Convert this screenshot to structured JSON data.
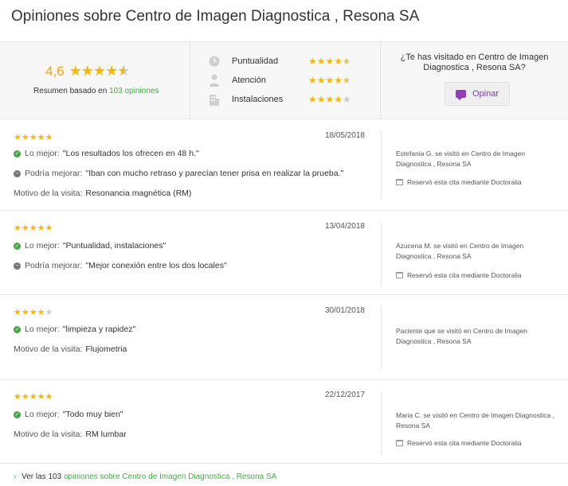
{
  "page_title": "Opiniones sobre Centro de Imagen Diagnostica , Resona SA",
  "summary": {
    "average": "4,6",
    "average_stars": 4.6,
    "based_on_prefix": "Resumen basado en",
    "opinions_link": "103 opiniones",
    "criteria": [
      {
        "label": "Puntualidad",
        "icon": "clock-icon",
        "rating": 4.5
      },
      {
        "label": "Atención",
        "icon": "person-icon",
        "rating": 4.5
      },
      {
        "label": "Instalaciones",
        "icon": "building-icon",
        "rating": 4
      }
    ],
    "question": "¿Te has visitado en Centro de Imagen Diagnostica , Resona SA?",
    "opinar_label": "Opinar"
  },
  "reviews": [
    {
      "rating": 5,
      "date": "18/05/2018",
      "best_label": "Lo mejor:",
      "best": "\"Los resultados los ofrecen en 48 h.\"",
      "improve_label": "Podría mejorar:",
      "improve": "\"Iban con mucho retraso y parecían tener prisa en realizar la prueba.\"",
      "reason_label": "Motivo de la visita:",
      "reason": "Resonancia magnética (RM)",
      "author": "Estefania G. se visitó en Centro de Imagen Diagnostica , Resona SA",
      "booked": "Reservó esta cita mediante Doctoralia"
    },
    {
      "rating": 5,
      "date": "13/04/2018",
      "best_label": "Lo mejor:",
      "best": "\"Puntualidad, instalaciones\"",
      "improve_label": "Podría mejorar:",
      "improve": "\"Mejor conexión entre los dos locales\"",
      "author": "Azucena M. se visitó en Centro de Imagen Diagnostica , Resona SA",
      "booked": "Reservó esta cita mediante Doctoralia"
    },
    {
      "rating": 4,
      "date": "30/01/2018",
      "best_label": "Lo mejor:",
      "best": "\"limpieza y rapidez\"",
      "reason_label": "Motivo de la visita:",
      "reason": "Flujometria",
      "author": "Paciente que se visitó en Centro de Imagen Diagnostica , Resona SA"
    },
    {
      "rating": 5,
      "date": "22/12/2017",
      "best_label": "Lo mejor:",
      "best": "\"Todo muy bien\"",
      "reason_label": "Motivo de la visita:",
      "reason": "RM lumbar",
      "author": "Maria C. se visitó en Centro de Imagen Diagnostica , Resona SA",
      "booked": "Reservó esta cita mediante Doctoralia"
    }
  ],
  "footer": {
    "prefix": "Ver las 103",
    "link": "opiniones sobre Centro de Imagen Diagnostica , Resona SA"
  },
  "colors": {
    "star": "#f5b800",
    "accent_green": "#47a547",
    "opinar_purple": "#8e3fb4"
  }
}
